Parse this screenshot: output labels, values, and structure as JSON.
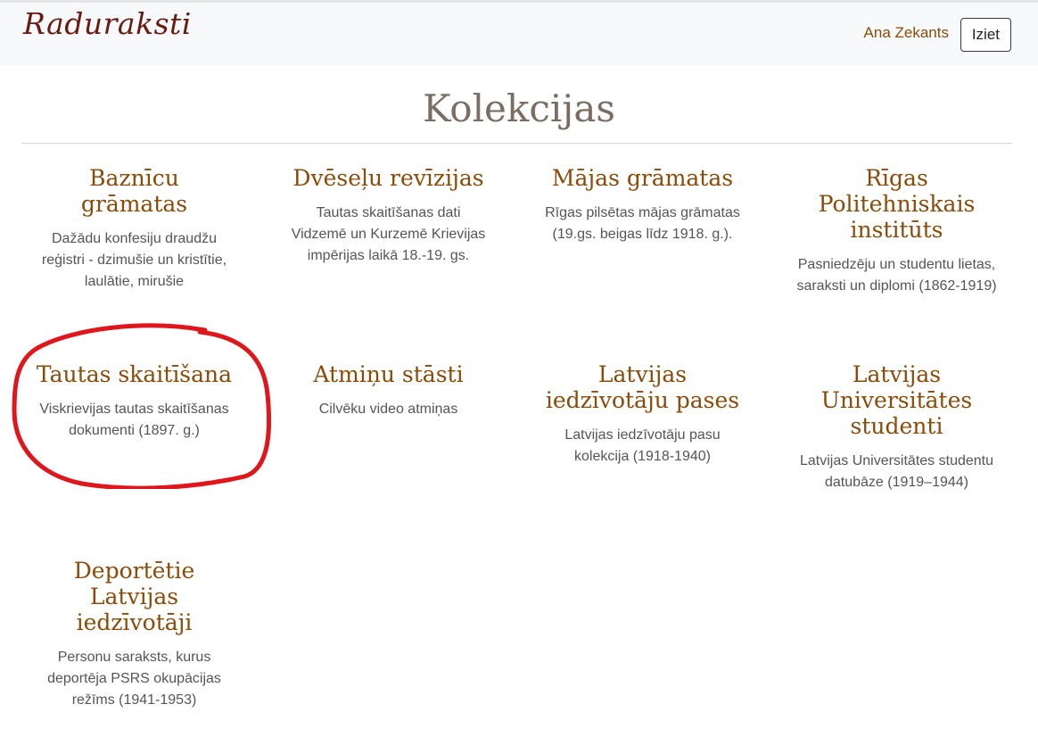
{
  "header": {
    "logo": "Raduraksti",
    "user_name": "Ana Zekants",
    "logout_label": "Iziet"
  },
  "main": {
    "title": "Kolekcijas",
    "collections": [
      {
        "title": "Baznīcu grāmatas",
        "description": "Dažādu konfesiju draudžu reģistri - dzimušie un kristītie, laulātie, mirušie"
      },
      {
        "title": "Dvēseļu revīzijas",
        "description": "Tautas skaitīšanas dati Vidzemē un Kurzemē Krievijas impērijas laikā 18.-19. gs."
      },
      {
        "title": "Mājas grāmatas",
        "description": "Rīgas pilsētas mājas grāmatas (19.gs. beigas līdz 1918. g.)."
      },
      {
        "title": "Rīgas Politehniskais institūts",
        "description": "Pasniedzēju un studentu lietas, saraksti un diplomi (1862-1919)"
      },
      {
        "title": "Tautas skaitīšana",
        "description": "Viskrievijas tautas skaitīšanas dokumenti (1897. g.)"
      },
      {
        "title": "Atmiņu stāsti",
        "description": "Cilvēku video atmiņas"
      },
      {
        "title": "Latvijas iedzīvotāju pases",
        "description": "Latvijas iedzīvotāju pasu kolekcija (1918-1940)"
      },
      {
        "title": "Latvijas Universitātes studenti",
        "description": "Latvijas Universitātes studentu datubāze (1919–1944)"
      },
      {
        "title": "Deportētie Latvijas iedzīvotāji",
        "description": "Personu saraksts, kurus deportēja PSRS okupācijas režīms (1941-1953)"
      }
    ]
  },
  "annotation": {
    "color": "#e0161d"
  }
}
